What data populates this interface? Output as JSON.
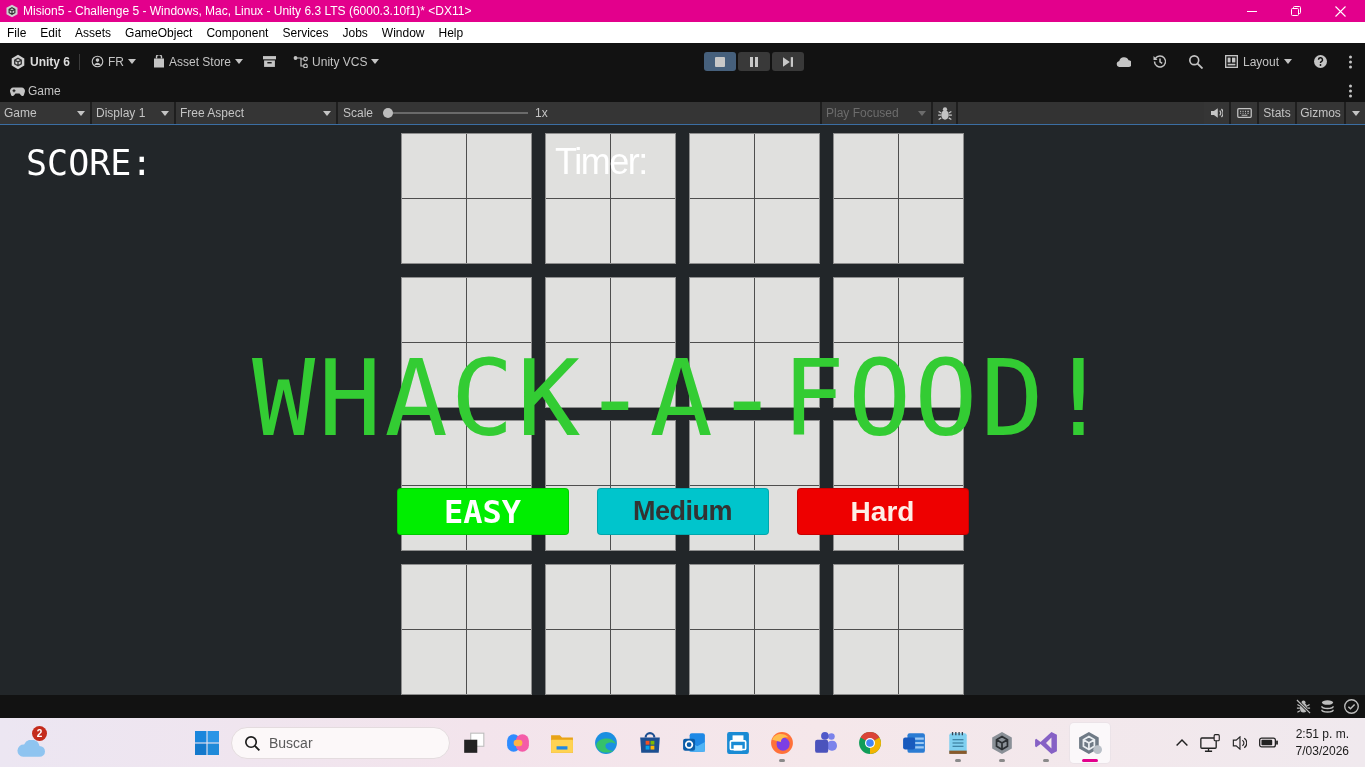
{
  "window": {
    "title": "Mision5 - Challenge 5 - Windows, Mac, Linux - Unity 6.3 LTS (6000.3.10f1)* <DX11>"
  },
  "menu_bar": {
    "items": [
      "File",
      "Edit",
      "Assets",
      "GameObject",
      "Component",
      "Services",
      "Jobs",
      "Window",
      "Help"
    ]
  },
  "toolbar": {
    "product": "Unity 6",
    "account": "FR",
    "asset_store": "Asset Store",
    "version_control": "Unity VCS",
    "playback": {
      "playing": true,
      "paused": false
    },
    "layout": "Layout"
  },
  "panel_tab": {
    "label": "Game"
  },
  "game_toolbar": {
    "view": "Game",
    "display": "Display 1",
    "aspect": "Free Aspect",
    "scale": {
      "label": "Scale",
      "level": 0,
      "reading": "1x"
    },
    "play_focused": {
      "label": "Play Focused",
      "disabled": true
    },
    "stats": "Stats",
    "gizmos": "Gizmos"
  },
  "game_view": {
    "score_label": "SCORE:",
    "timer_label": "Timer:",
    "title": "WHACK-A-FOOD!",
    "difficulty_buttons": [
      {
        "label": "EASY",
        "color": "#00ee00"
      },
      {
        "label": "Medium",
        "color": "#00c5cc"
      },
      {
        "label": "Hard",
        "color": "#ee0000"
      }
    ]
  },
  "taskbar": {
    "weather_badge": "2",
    "search": {
      "placeholder": "Buscar"
    },
    "apps": [
      {
        "kind": "taskview",
        "running": false,
        "active": false
      },
      {
        "kind": "copilot",
        "running": false,
        "active": false
      },
      {
        "kind": "explorer",
        "running": false,
        "active": false
      },
      {
        "kind": "edge",
        "running": false,
        "active": false
      },
      {
        "kind": "store",
        "running": false,
        "active": false
      },
      {
        "kind": "outlook",
        "running": false,
        "active": false
      },
      {
        "kind": "printer",
        "running": false,
        "active": false
      },
      {
        "kind": "firefox",
        "running": true,
        "active": false
      },
      {
        "kind": "teams",
        "running": false,
        "active": false
      },
      {
        "kind": "chrome",
        "running": false,
        "active": false
      },
      {
        "kind": "word",
        "running": false,
        "active": false
      },
      {
        "kind": "notepad",
        "running": true,
        "active": false
      },
      {
        "kind": "hub",
        "running": true,
        "active": false
      },
      {
        "kind": "studio",
        "running": true,
        "active": false
      },
      {
        "kind": "editor",
        "running": true,
        "active": true
      }
    ],
    "clock": {
      "time": "2:51 p. m.",
      "date": "7/03/2026"
    }
  }
}
